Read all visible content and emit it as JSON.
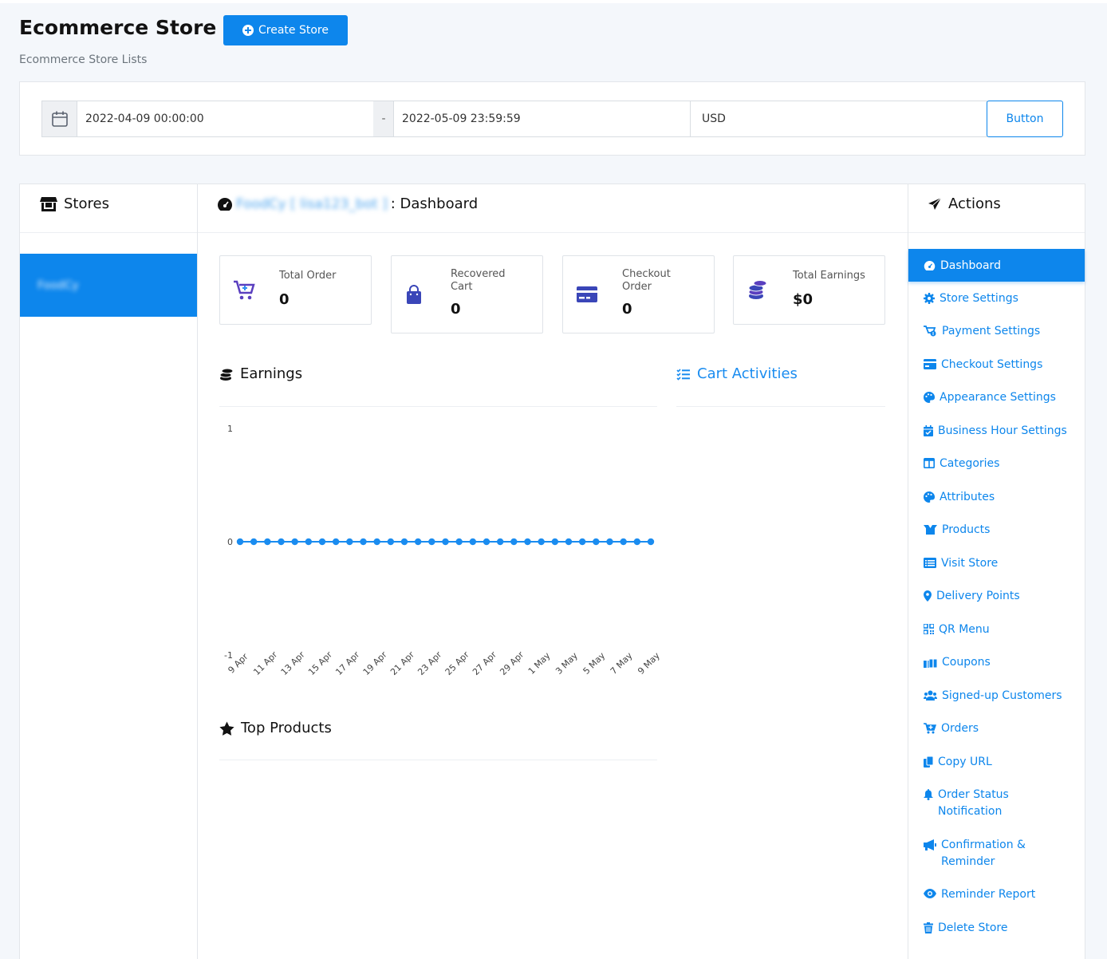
{
  "header": {
    "title": "Ecommerce Store",
    "create_button": "Create Store",
    "subtitle": "Ecommerce Store Lists"
  },
  "filters": {
    "start_date": "2022-04-09 00:00:00",
    "separator": "-",
    "end_date": "2022-05-09 23:59:59",
    "currency": "USD",
    "button_label": "Button"
  },
  "stores": {
    "heading": "Stores",
    "items": [
      {
        "label": "FoodCy",
        "active": true
      }
    ]
  },
  "dashboard": {
    "heading_store": "FoodCy [ lisa123_bot ]",
    "heading_suffix": ": Dashboard",
    "stats": [
      {
        "label_lines": [
          "Total Order"
        ],
        "value": "0",
        "icon": "cart-plus-icon"
      },
      {
        "label_lines": [
          "Recovered",
          "Cart"
        ],
        "value": "0",
        "icon": "shopping-bag-icon"
      },
      {
        "label_lines": [
          "Checkout",
          "Order"
        ],
        "value": "0",
        "icon": "credit-card-icon"
      },
      {
        "label_lines": [
          "Total Earnings"
        ],
        "value": "$0",
        "icon": "coins-icon"
      }
    ],
    "earnings_heading": "Earnings",
    "cart_activities_heading": "Cart Activities",
    "top_products_heading": "Top Products"
  },
  "chart_data": {
    "type": "line",
    "x": [
      "9 Apr",
      "10 Apr",
      "11 Apr",
      "12 Apr",
      "13 Apr",
      "14 Apr",
      "15 Apr",
      "16 Apr",
      "17 Apr",
      "18 Apr",
      "19 Apr",
      "20 Apr",
      "21 Apr",
      "22 Apr",
      "23 Apr",
      "24 Apr",
      "25 Apr",
      "26 Apr",
      "27 Apr",
      "28 Apr",
      "29 Apr",
      "30 Apr",
      "1 May",
      "2 May",
      "3 May",
      "4 May",
      "5 May",
      "6 May",
      "7 May",
      "8 May",
      "9 May"
    ],
    "tick_labels": [
      "9 Apr",
      "11 Apr",
      "13 Apr",
      "15 Apr",
      "17 Apr",
      "19 Apr",
      "21 Apr",
      "23 Apr",
      "25 Apr",
      "27 Apr",
      "29 Apr",
      "1 May",
      "3 May",
      "5 May",
      "7 May",
      "9 May"
    ],
    "series": [
      {
        "values": [
          0,
          0,
          0,
          0,
          0,
          0,
          0,
          0,
          0,
          0,
          0,
          0,
          0,
          0,
          0,
          0,
          0,
          0,
          0,
          0,
          0,
          0,
          0,
          0,
          0,
          0,
          0,
          0,
          0,
          0,
          0
        ]
      }
    ],
    "ylim": [
      -1,
      1
    ],
    "yticks": [
      "1",
      "0",
      "-1"
    ],
    "color": "#1a8cf0",
    "grid": false
  },
  "actions": {
    "heading": "Actions",
    "items": [
      {
        "label": "Dashboard",
        "icon": "gauge-icon",
        "active": true
      },
      {
        "label": "Store Settings",
        "icon": "gear-icon"
      },
      {
        "label": "Payment Settings",
        "icon": "cart-dollar-icon"
      },
      {
        "label": "Checkout Settings",
        "icon": "credit-card-icon"
      },
      {
        "label": "Appearance Settings",
        "icon": "palette-icon"
      },
      {
        "label": "Business Hour Settings",
        "icon": "calendar-check-icon"
      },
      {
        "label": "Categories",
        "icon": "columns-icon"
      },
      {
        "label": "Attributes",
        "icon": "palette-icon"
      },
      {
        "label": "Products",
        "icon": "box-open-icon"
      },
      {
        "label": "Visit Store",
        "icon": "list-alt-icon"
      },
      {
        "label": "Delivery Points",
        "icon": "map-marker-icon"
      },
      {
        "label": "QR Menu",
        "icon": "qrcode-icon"
      },
      {
        "label": "Coupons",
        "icon": "gifts-icon"
      },
      {
        "label": "Signed-up Customers",
        "icon": "users-icon"
      },
      {
        "label": "Orders",
        "icon": "cart-plus-icon"
      },
      {
        "label": "Copy URL",
        "icon": "copy-icon"
      },
      {
        "label": "Order Status Notification",
        "icon": "bell-icon"
      },
      {
        "label": "Confirmation & Reminder",
        "icon": "bullhorn-icon"
      },
      {
        "label": "Reminder Report",
        "icon": "eye-icon"
      },
      {
        "label": "Delete Store",
        "icon": "trash-icon"
      }
    ]
  }
}
